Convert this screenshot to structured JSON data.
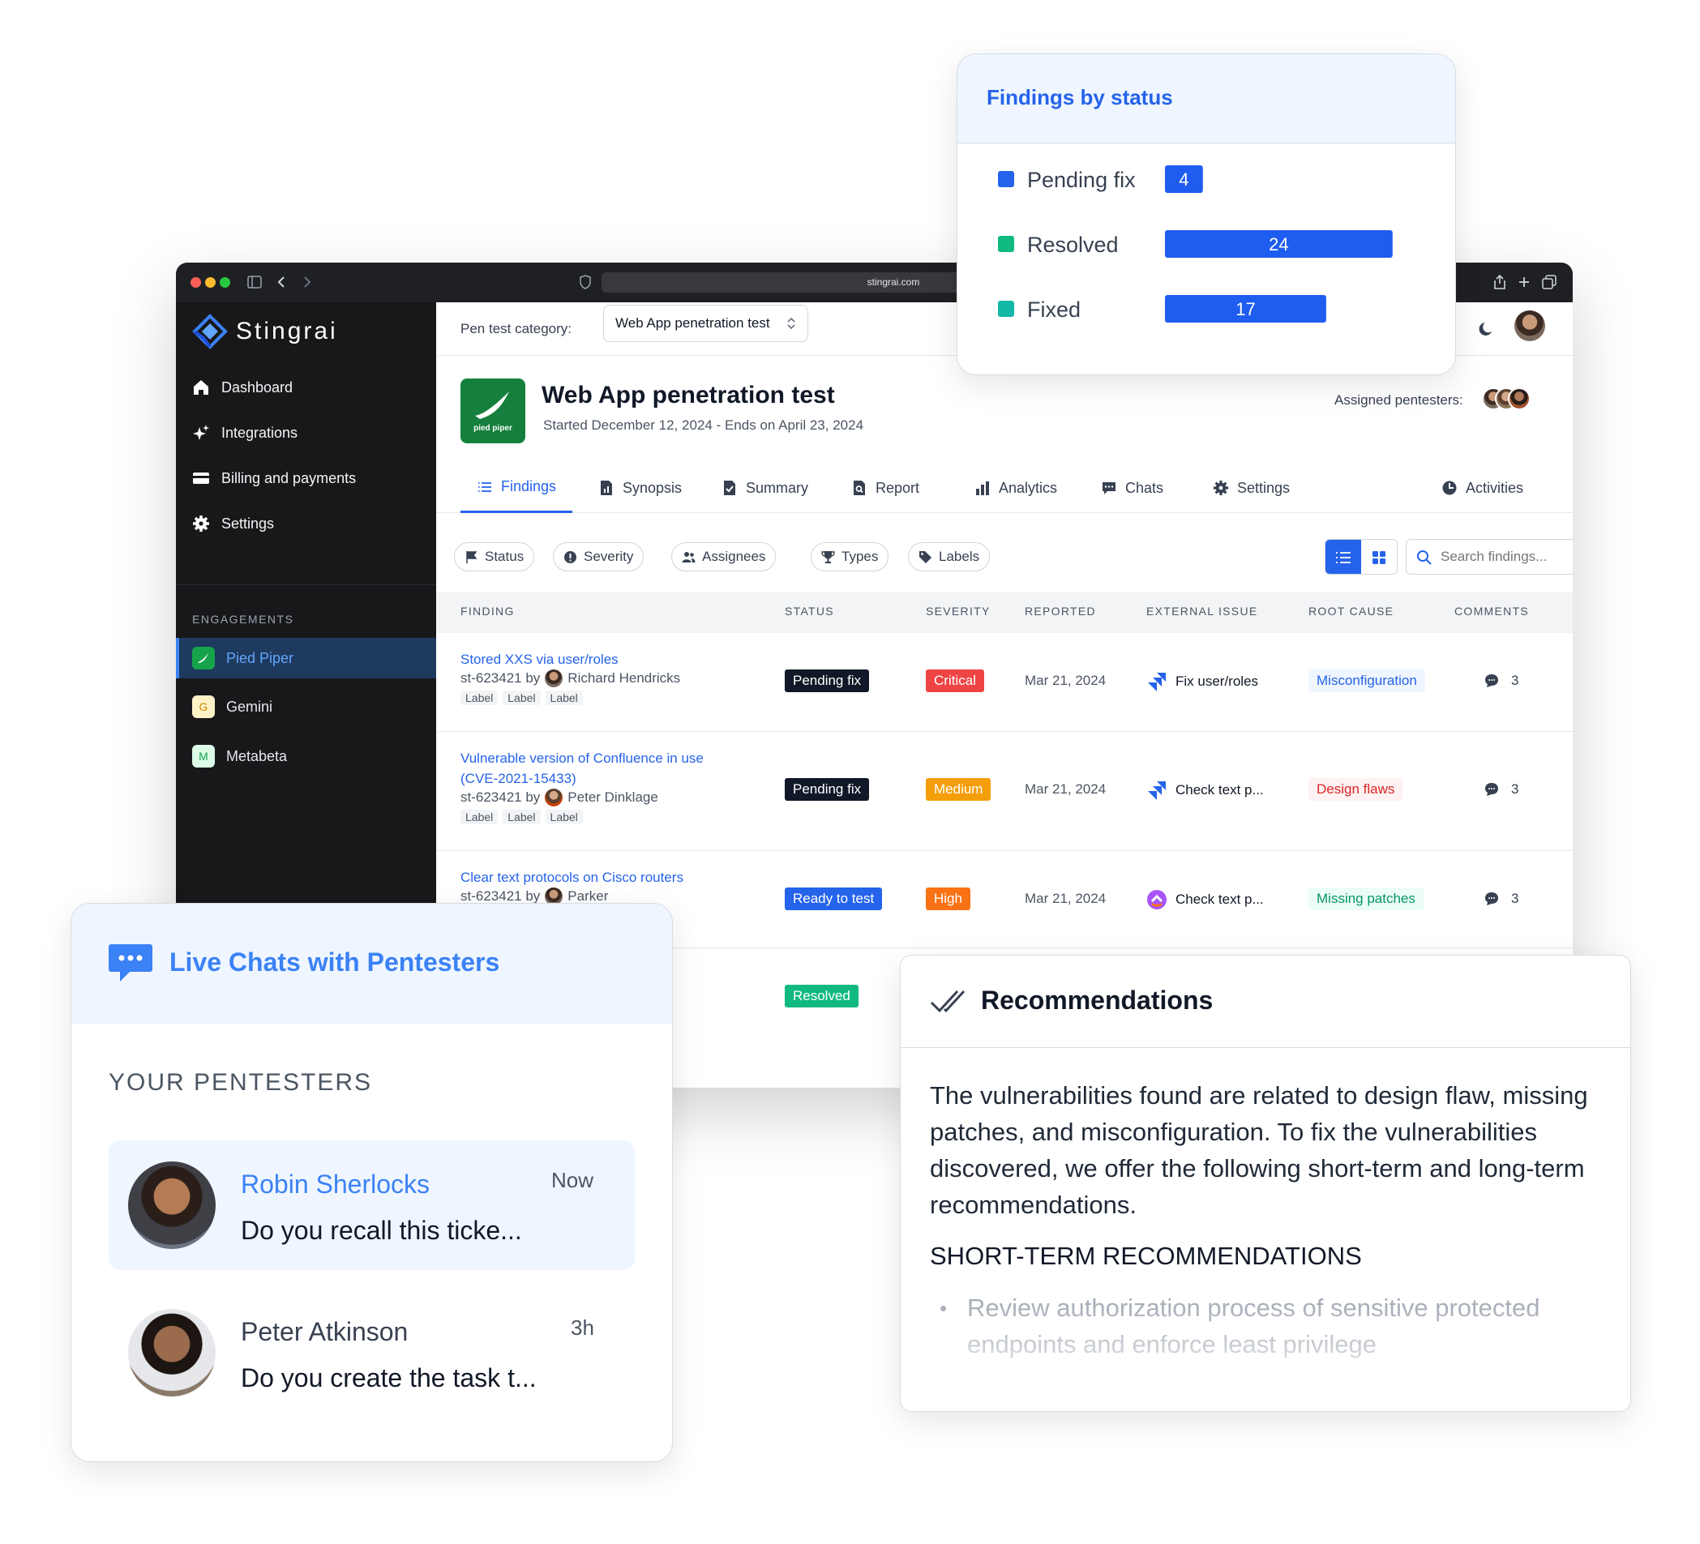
{
  "browser": {
    "url": "stingrai.com"
  },
  "sidebar": {
    "brand": "Stingrai",
    "items": [
      {
        "label": "Dashboard",
        "icon": "home-icon"
      },
      {
        "label": "Integrations",
        "icon": "sparkle-icon"
      },
      {
        "label": "Billing and payments",
        "icon": "credit-card-icon"
      },
      {
        "label": "Settings",
        "icon": "gear-icon"
      }
    ],
    "engagements_heading": "ENGAGEMENTS",
    "engagements": [
      {
        "label": "Pied Piper",
        "letter": ""
      },
      {
        "label": "Gemini",
        "letter": "G"
      },
      {
        "label": "Metabeta",
        "letter": "M"
      }
    ]
  },
  "topbar": {
    "category_label": "Pen test category:",
    "category_value": "Web App penetration test"
  },
  "project": {
    "logo_text": "pied piper",
    "title": "Web App penetration test",
    "dates": "Started December 12, 2024 - Ends on April 23, 2024",
    "assigned_label": "Assigned pentesters:"
  },
  "tabs": [
    "Findings",
    "Synopsis",
    "Summary",
    "Report",
    "Analytics",
    "Chats",
    "Settings",
    "Activities"
  ],
  "filters": [
    "Status",
    "Severity",
    "Assignees",
    "Types",
    "Labels"
  ],
  "search": {
    "placeholder": "Search findings..."
  },
  "table": {
    "headers": [
      "FINDING",
      "STATUS",
      "SEVERITY",
      "REPORTED",
      "EXTERNAL ISSUE",
      "ROOT CAUSE",
      "COMMENTS"
    ],
    "rows": [
      {
        "title": "Stored XXS via user/roles",
        "title2": "",
        "id": "st-623421 by",
        "author": "Richard Hendricks",
        "labels": [
          "Label",
          "Label",
          "Label"
        ],
        "status": "Pending fix",
        "severity": "Critical",
        "reported": "Mar 21, 2024",
        "external": "Fix user/roles",
        "root_cause": "Misconfiguration",
        "comments": "3"
      },
      {
        "title": "Vulnerable version of Confluence in use",
        "title2": "(CVE-2021-15433)",
        "id": "st-623421 by",
        "author": "Peter Dinklage",
        "labels": [
          "Label",
          "Label",
          "Label"
        ],
        "status": "Pending fix",
        "severity": "Medium",
        "reported": "Mar 21, 2024",
        "external": "Check text p...",
        "root_cause": "Design flaws",
        "comments": "3"
      },
      {
        "title": "Clear text protocols on Cisco routers",
        "title2": "",
        "id": "st-623421 by",
        "author": "Parker",
        "labels": [],
        "status": "Ready to test",
        "severity": "High",
        "reported": "Mar 21, 2024",
        "external": "Check text p...",
        "root_cause": "Missing patches",
        "comments": "3"
      },
      {
        "status": "Resolved"
      }
    ]
  },
  "status_card": {
    "title": "Findings by status",
    "colors": {
      "Pending fix": "#2563eb",
      "Resolved": "#10b981",
      "Fixed": "#14b8a6",
      "bar": "#1f5cf0"
    }
  },
  "chart_data": {
    "type": "bar",
    "title": "Findings by status",
    "categories": [
      "Pending fix",
      "Resolved",
      "Fixed"
    ],
    "values": [
      4,
      24,
      17
    ]
  },
  "chats_card": {
    "title": "Live Chats with Pentesters",
    "heading": "YOUR PENTESTERS",
    "chats": [
      {
        "name": "Robin Sherlocks",
        "time": "Now",
        "message": "Do you recall this ticke..."
      },
      {
        "name": "Peter Atkinson",
        "time": "3h",
        "message": "Do you create the task t..."
      }
    ]
  },
  "recs_card": {
    "title": "Recommendations",
    "body": "The vulnerabilities found are related to design flaw, missing patches, and misconfiguration. To fix the vulnerabilities discovered, we offer the following short-term and long-term recommendations.",
    "subheading": "SHORT-TERM RECOMMENDATIONS",
    "bullet": "Review authorization process of sensitive protected endpoints and enforce least privilege"
  }
}
